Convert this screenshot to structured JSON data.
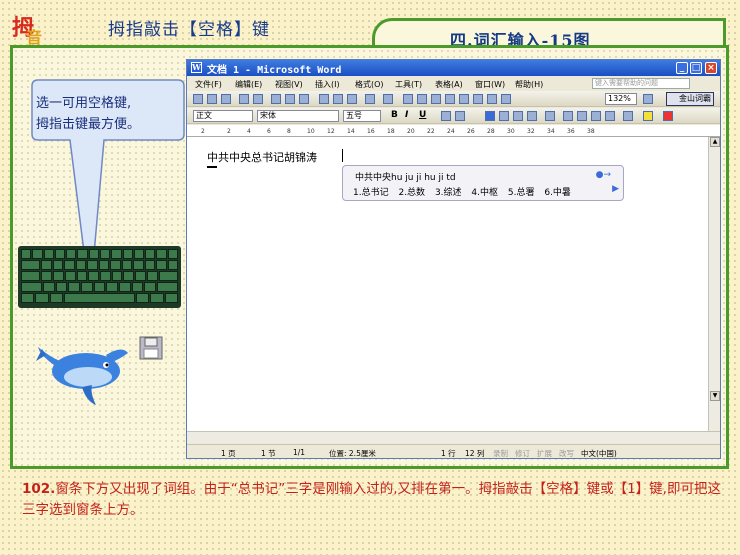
{
  "header": {
    "logo_char1": "拇",
    "logo_char2": "音",
    "title": "拇指敲击【空格】键",
    "section_label": "四.词汇输入-15图"
  },
  "bubble": {
    "line1": "选一可用空格键,",
    "line2": "拇指击键最方便。"
  },
  "word": {
    "title": "文档 1 - Microsoft Word",
    "menu": [
      "文件(F)",
      "编辑(E)",
      "视图(V)",
      "插入(I)",
      "格式(O)",
      "工具(T)",
      "表格(A)",
      "窗口(W)",
      "帮助(H)"
    ],
    "help_placeholder": "键入需要帮助的问题",
    "zoom": "132%",
    "jinshan": "金山词霸",
    "style_select": "正文",
    "font_select": "宋体",
    "size_select": "五号",
    "doc_text": "中共中央总书记胡锦涛",
    "ime": {
      "composition": "中共中央hu ju ji hu ji td",
      "candidates": [
        "1.总书记",
        "2.总数",
        "3.综述",
        "4.中枢",
        "5.总署",
        "6.中暑"
      ],
      "more_indicator": "▶",
      "dot_indicator": "●→"
    },
    "status": {
      "page": "1 页",
      "section": "1 节",
      "pages": "1/1",
      "position": "位置: 2.5厘米",
      "line": "1 行",
      "col": "12 列",
      "rec": "录制",
      "mod": "修订",
      "ext": "扩展",
      "ovr": "改写",
      "lang": "中文(中国)"
    }
  },
  "caption": {
    "number": "102.",
    "text": "窗条下方又出现了词组。由于“总书记”三字是刚输入过的,又排在第一。拇指敲击【空格】键或【1】键,即可把这三字选到窗条上方。"
  },
  "colors": {
    "border_green": "#4d9a2c",
    "title_blue": "#183b8c",
    "caption_red": "#c4211b"
  }
}
